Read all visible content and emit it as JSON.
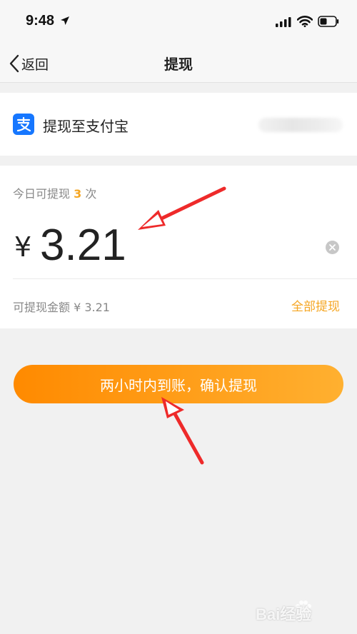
{
  "status_bar": {
    "time": "9:48"
  },
  "nav": {
    "back_label": "返回",
    "title": "提现"
  },
  "alipay": {
    "label": "提现至支付宝",
    "icon": "alipay-icon",
    "brand_color": "#1677ff"
  },
  "amount": {
    "quota_prefix": "今日可提现",
    "quota_count": "3",
    "quota_suffix": "次",
    "currency": "¥",
    "value": "3.21",
    "available_text": "可提现金额 ¥ 3.21",
    "withdraw_all_label": "全部提现"
  },
  "confirm": {
    "label": "两小时内到账，确认提现"
  },
  "watermark": {
    "text": "Bai经验"
  },
  "colors": {
    "accent": "#f5a623",
    "button_gradient_start": "#ff8a00",
    "button_gradient_end": "#ffb030",
    "annotation_arrow": "#ee2a2a"
  }
}
